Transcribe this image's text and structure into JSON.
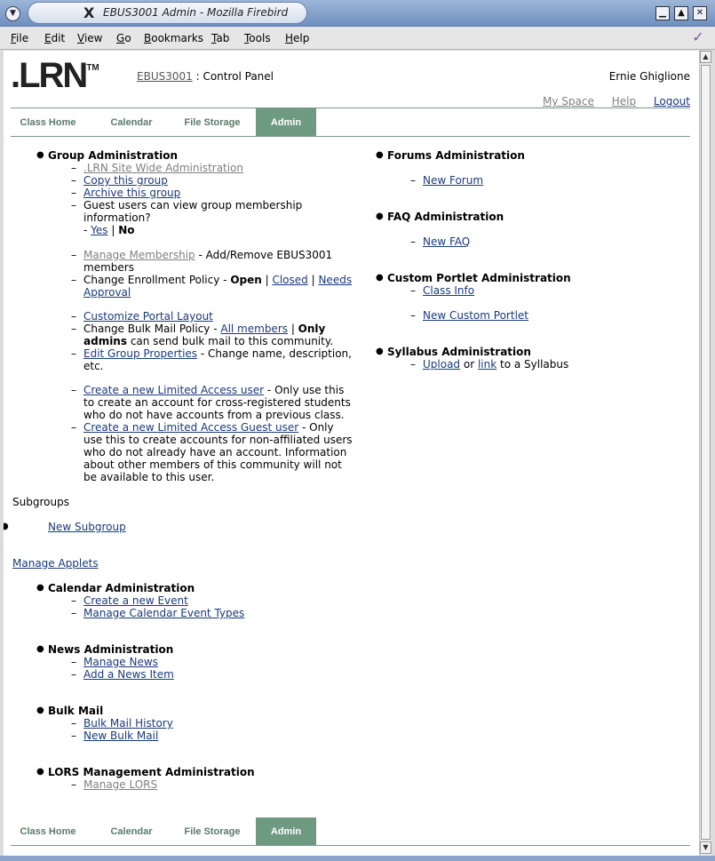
{
  "window": {
    "title": "EBUS3001 Admin - Mozilla Firebird",
    "menu": [
      {
        "label": "File",
        "mnemonic": "F",
        "rest": "ile"
      },
      {
        "label": "Edit",
        "mnemonic": "E",
        "rest": "dit"
      },
      {
        "label": "View",
        "mnemonic": "V",
        "rest": "iew"
      },
      {
        "label": "Go",
        "mnemonic": "G",
        "rest": "o"
      },
      {
        "label": "Bookmarks",
        "mnemonic": "B",
        "rest": "ookmarks"
      },
      {
        "label": "Tab",
        "mnemonic": "T",
        "rest": "ab"
      },
      {
        "label": "Tools",
        "mnemonic": "T",
        "rest": "ools"
      },
      {
        "label": "Help",
        "mnemonic": "H",
        "rest": "elp"
      }
    ]
  },
  "header": {
    "logo": ".LRN",
    "logo_tm": "TM",
    "course_link": "EBUS3001",
    "course_suffix": " : Control Panel",
    "user": "Ernie Ghiglione",
    "links": {
      "my_space": "My Space",
      "help": "Help",
      "logout": "Logout"
    }
  },
  "tabs": [
    "Class Home",
    "Calendar",
    "File Storage",
    "Admin"
  ],
  "group_admin": {
    "title": "Group Administration",
    "site_wide": ".LRN Site Wide Administration",
    "copy": "Copy this group",
    "archive": "Archive this group",
    "guest_q": "Guest users can view group membership information?",
    "guest_dash": "- ",
    "guest_yes": "Yes",
    "guest_sep": " | ",
    "guest_no": "No",
    "manage_membership": "Manage Membership",
    "membership_rest": " - Add/Remove EBUS3001 members",
    "enroll_label": "Change Enrollment Policy - ",
    "enroll_open": "Open",
    "enroll_sep1": " | ",
    "enroll_closed": "Closed",
    "enroll_sep2": " | ",
    "enroll_needs": "Needs Approval",
    "customize": "Customize Portal Layout",
    "bulk_label": "Change Bulk Mail Policy - ",
    "bulk_all": "All members",
    "bulk_sep": " | ",
    "bulk_only": "Only admins",
    "bulk_rest": " can send bulk mail to this community.",
    "edit_props": "Edit Group Properties",
    "edit_rest": " - Change name, description, etc.",
    "limited": "Create a new Limited Access user",
    "limited_rest": " - Only use this to create an account for cross-registered students who do not have accounts from a previous class.",
    "limited_guest": "Create a new Limited Access Guest user",
    "limited_guest_rest": " - Only use this to create accounts for non-affiliated users who do not already have an account. Information about other members of this community will not be available to this user."
  },
  "right": {
    "forums": {
      "title": "Forums Administration",
      "link": "New Forum"
    },
    "faq": {
      "title": "FAQ Administration",
      "link": "New FAQ"
    },
    "portlet": {
      "title": "Custom Portlet Administration",
      "link1": "Class Info",
      "link2": "New Custom Portlet"
    },
    "syllabus": {
      "title": "Syllabus Administration",
      "upload": "Upload",
      "or": " or ",
      "link": "link",
      "rest": " to a Syllabus"
    }
  },
  "subgroups": {
    "title": "Subgroups",
    "new": "New Subgroup"
  },
  "applets": {
    "manage": "Manage Applets",
    "calendar": {
      "title": "Calendar Administration",
      "l1": "Create a new Event",
      "l2": "Manage Calendar Event Types"
    },
    "news": {
      "title": "News Administration",
      "l1": "Manage News",
      "l2": "Add a News Item"
    },
    "bulk": {
      "title": "Bulk Mail",
      "l1": "Bulk Mail History",
      "l2": "New Bulk Mail"
    },
    "lors": {
      "title": "LORS Management Administration",
      "l1": "Manage LORS"
    }
  },
  "glyphs": {
    "bullet": "●",
    "dash": "–"
  }
}
